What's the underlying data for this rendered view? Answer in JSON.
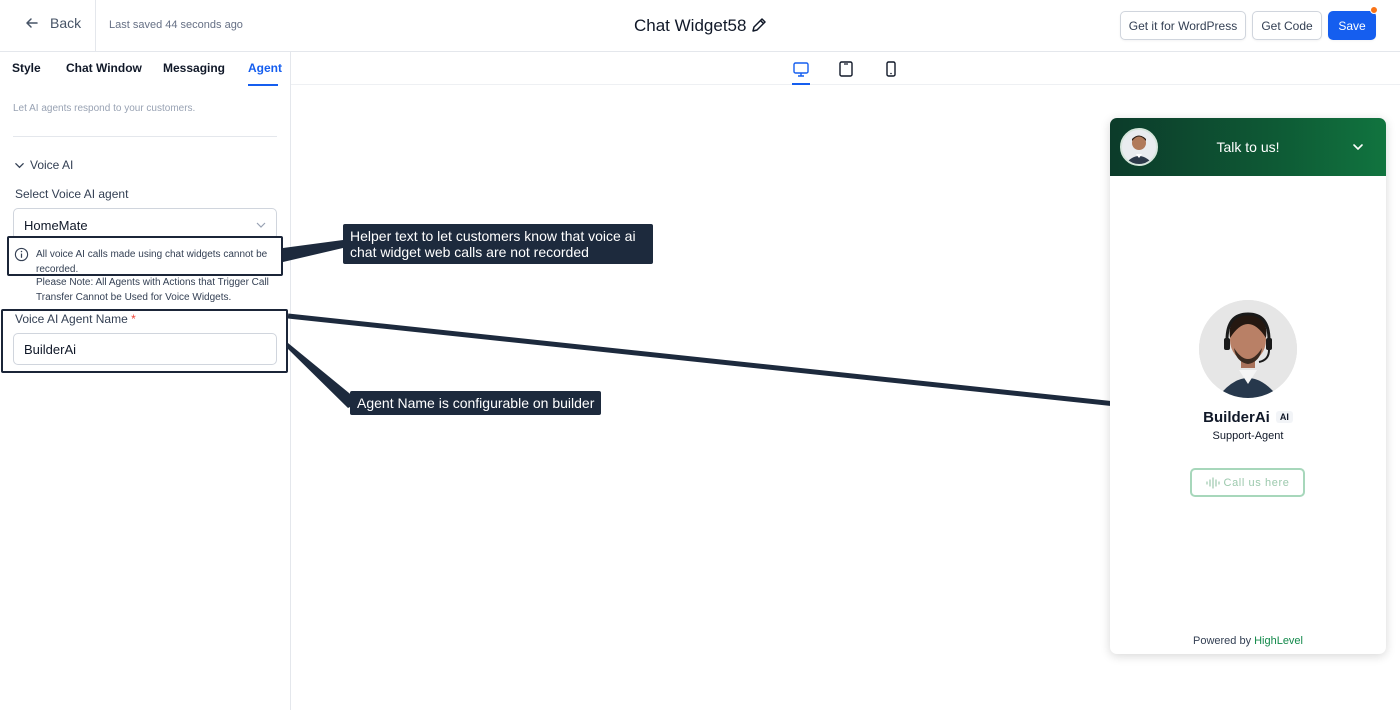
{
  "header": {
    "back_label": "Back",
    "last_saved": "Last saved 44 seconds ago",
    "title": "Chat Widget58",
    "wordpress_button": "Get it for WordPress",
    "code_button": "Get Code",
    "save_button": "Save"
  },
  "tabs": [
    {
      "label": "Style"
    },
    {
      "label": "Chat Window"
    },
    {
      "label": "Messaging"
    },
    {
      "label": "Agent",
      "active": true
    }
  ],
  "panel": {
    "subtitle": "Let AI agents respond to your customers.",
    "section_title": "Voice AI",
    "select_label": "Select Voice AI agent",
    "select_value": "HomeMate",
    "helper_text": "All voice AI calls made using chat widgets cannot be recorded.",
    "note_text": "Please Note: All Agents with Actions that Trigger Call Transfer Cannot be Used for Voice Widgets.",
    "name_label": "Voice AI Agent Name",
    "required_mark": "*",
    "name_value": "BuilderAi"
  },
  "devices": [
    {
      "icon": "desktop-icon",
      "active": true
    },
    {
      "icon": "tablet-icon",
      "active": false
    },
    {
      "icon": "mobile-icon",
      "active": false
    }
  ],
  "callouts": {
    "helper": "Helper text to let customers know that voice ai chat widget web calls are not recorded",
    "name": "Agent Name is configurable on builder"
  },
  "widget": {
    "header_title": "Talk to us!",
    "agent_name": "BuilderAi",
    "ai_badge": "AI",
    "agent_role": "Support-Agent",
    "call_button": "Call us here",
    "powered_by": "Powered by",
    "brand": "HighLevel"
  },
  "colors": {
    "accent": "#155eef",
    "widget_header": "#0e5a35",
    "callout_bg": "#1d2a3d",
    "brand": "#12894a"
  }
}
